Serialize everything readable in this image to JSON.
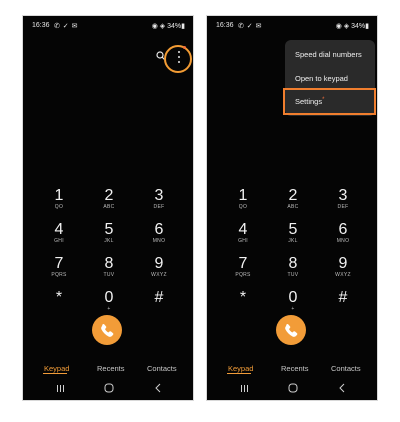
{
  "status_bar": {
    "time": "16:36",
    "notifications": "✆ ✓ ✉",
    "battery": "◉ ◈ 34%▮"
  },
  "keypad": {
    "keys": [
      {
        "digit": "1",
        "letters": "QO"
      },
      {
        "digit": "2",
        "letters": "ABC"
      },
      {
        "digit": "3",
        "letters": "DEF"
      },
      {
        "digit": "4",
        "letters": "GHI"
      },
      {
        "digit": "5",
        "letters": "JKL"
      },
      {
        "digit": "6",
        "letters": "MNO"
      },
      {
        "digit": "7",
        "letters": "PQRS"
      },
      {
        "digit": "8",
        "letters": "TUV"
      },
      {
        "digit": "9",
        "letters": "WXYZ"
      },
      {
        "digit": "*",
        "letters": ""
      },
      {
        "digit": "0",
        "letters": "+"
      },
      {
        "digit": "#",
        "letters": ""
      }
    ]
  },
  "tabs": {
    "keypad": "Keypad",
    "recents": "Recents",
    "contacts": "Contacts"
  },
  "menu": {
    "speed_dial": "Speed dial numbers",
    "open_keypad": "Open to keypad",
    "settings": "Settings",
    "settings_badge": "*"
  },
  "colors": {
    "accent": "#f29c38",
    "highlight": "#f07e2e",
    "background": "#050505",
    "menu_bg": "#2a2a2a"
  },
  "icons": {
    "search": "search-icon",
    "more": "more-vertical-icon",
    "call": "phone-icon",
    "recent_apps": "recent-apps-icon",
    "home": "home-icon",
    "back": "back-icon"
  }
}
